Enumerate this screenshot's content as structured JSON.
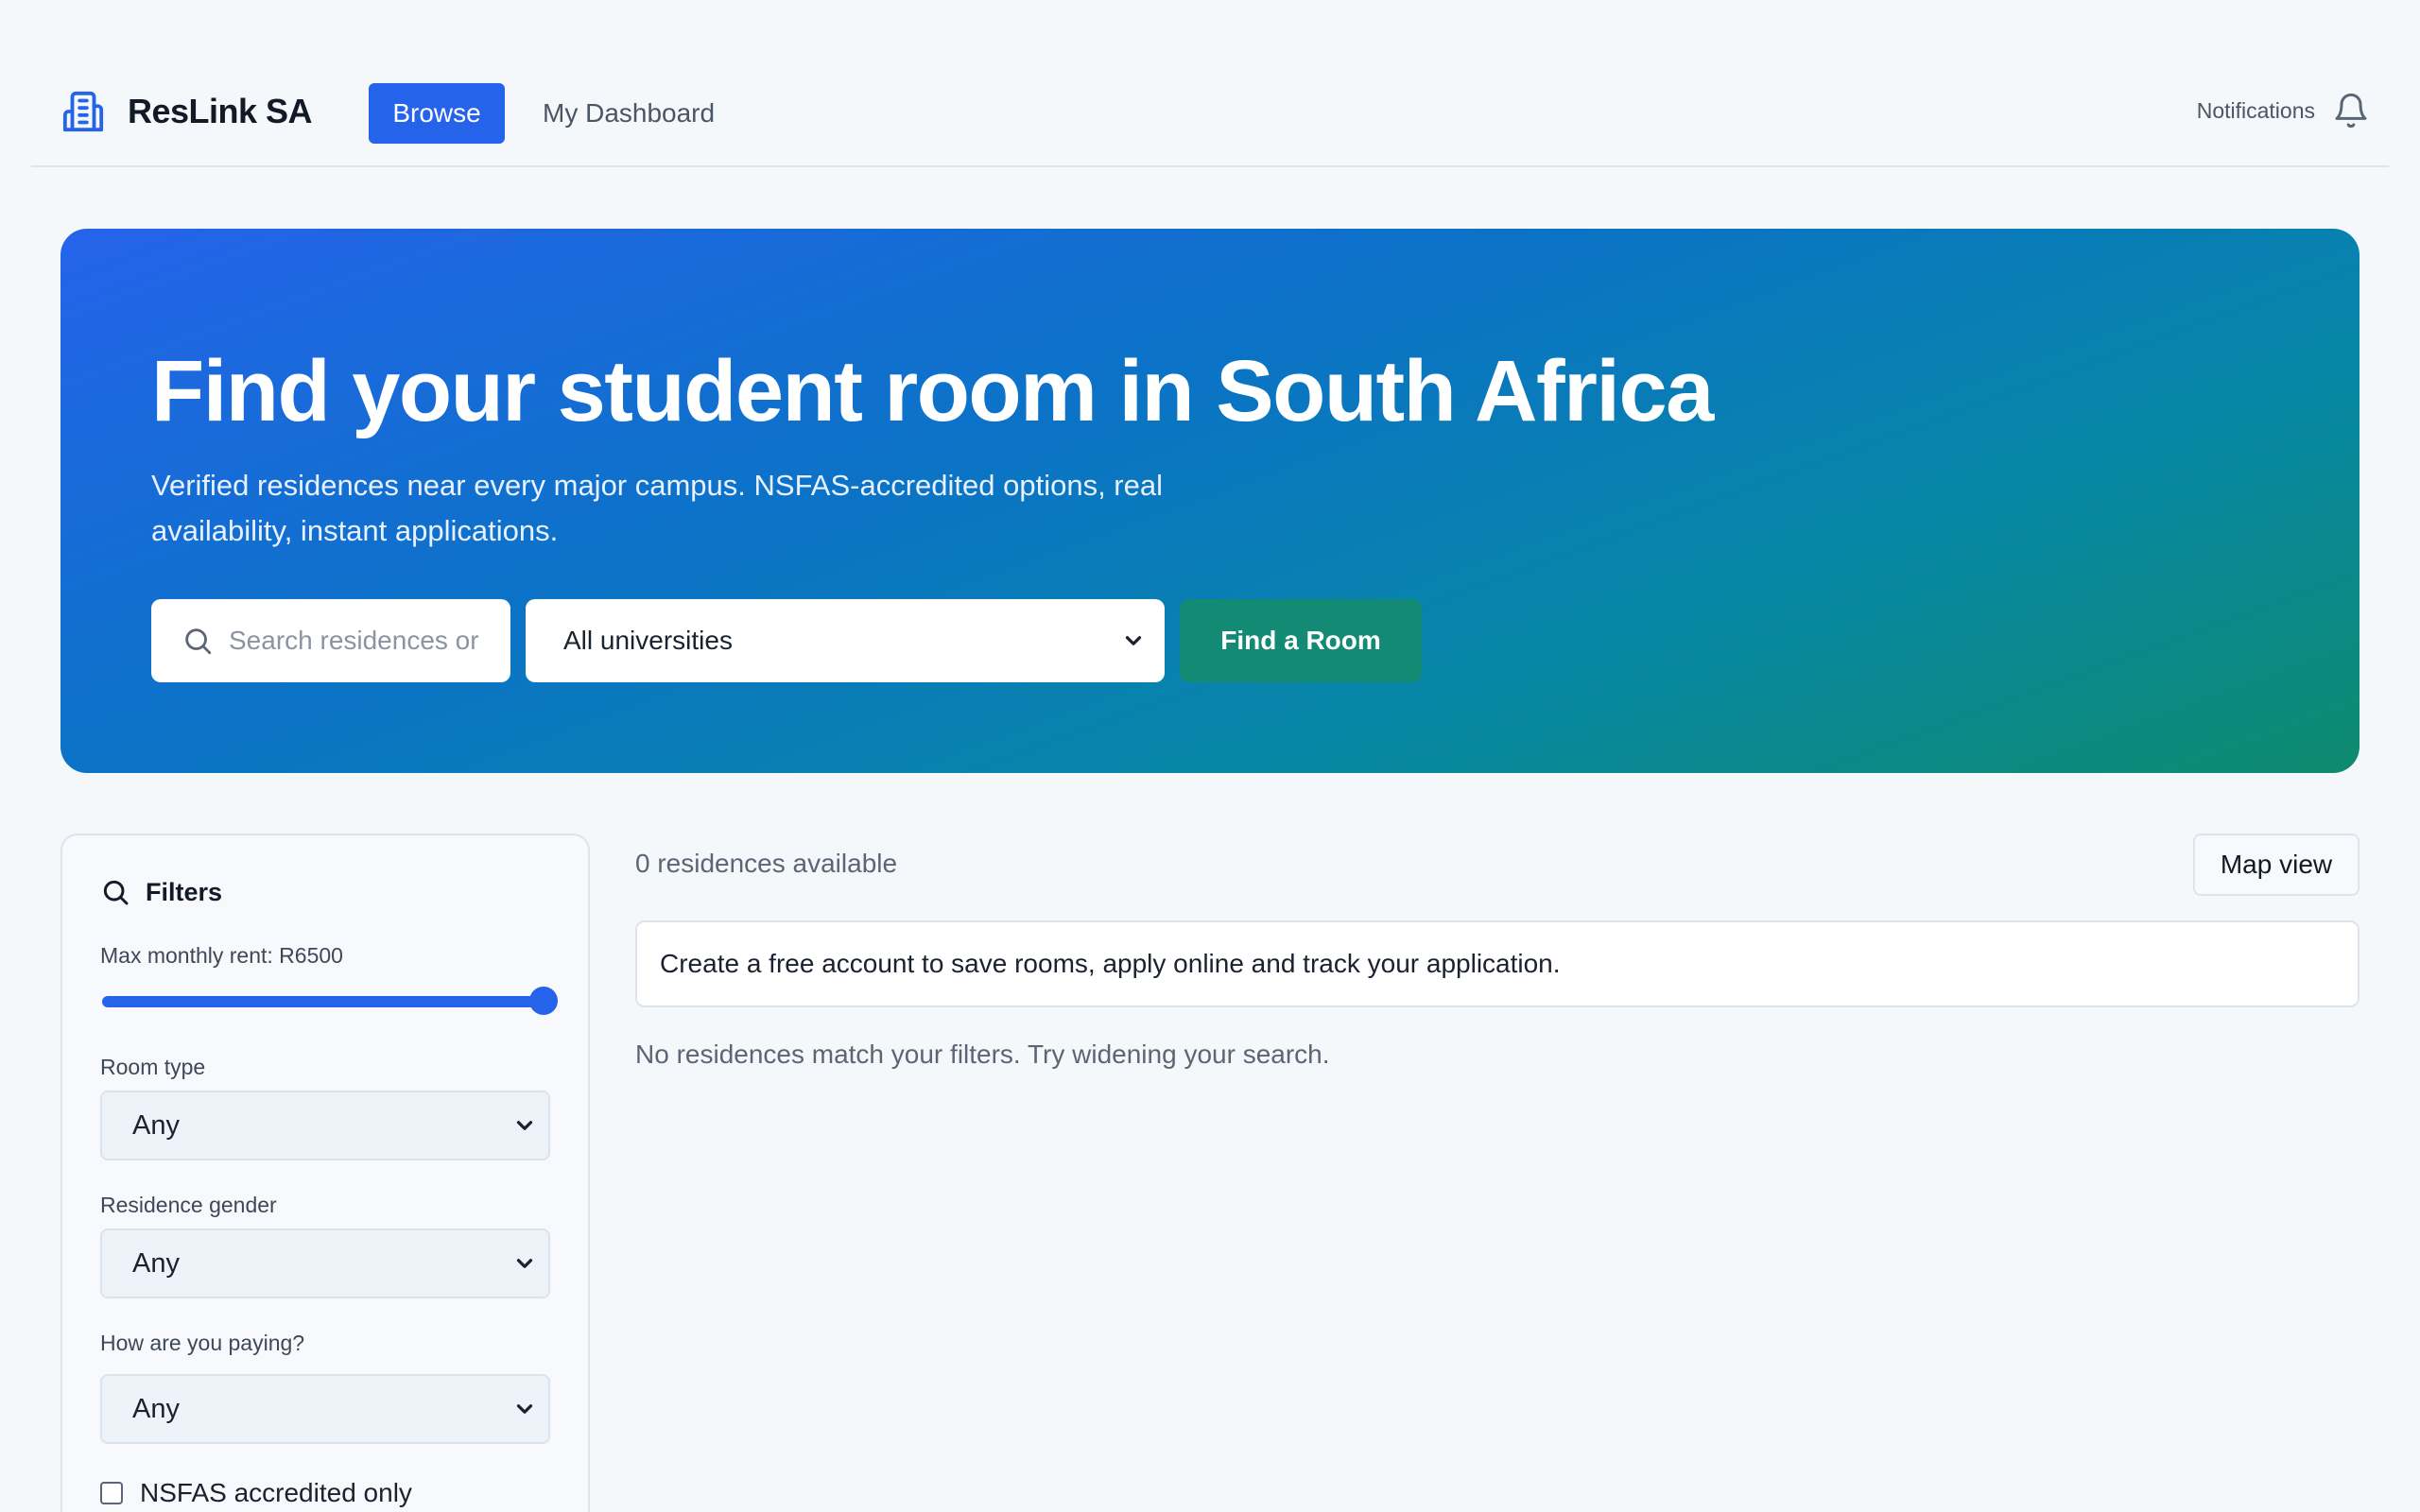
{
  "header": {
    "brand": "ResLink SA",
    "nav": {
      "browse": "Browse",
      "dashboard": "My Dashboard"
    },
    "notifications_label": "Notifications"
  },
  "hero": {
    "title": "Find your student room in South Africa",
    "subtitle": "Verified residences near every major campus. NSFAS-accredited options, real availability, instant applications.",
    "search_placeholder": "Search residences or",
    "university_select": "All universities",
    "find_button": "Find a Room"
  },
  "filters": {
    "title": "Filters",
    "max_rent_label": "Max monthly rent: R6500",
    "max_rent_fraction": 1.0,
    "room_type": {
      "label": "Room type",
      "value": "Any"
    },
    "gender": {
      "label": "Residence gender",
      "value": "Any"
    },
    "payment": {
      "label": "How are you paying?",
      "value": "Any"
    },
    "nsfas_only": {
      "label": "NSFAS accredited only",
      "checked": false
    }
  },
  "results": {
    "count": "0 residences available",
    "map_view": "Map view",
    "signup_notice": "Create a free account to save rooms, apply online and track your application.",
    "empty_message": "No residences match your filters. Try widening your search."
  },
  "colors": {
    "primary": "#2563eb",
    "accent_green": "#128a74",
    "background": "#f5f8fb"
  },
  "icons": [
    "building-icon",
    "bell-icon",
    "search-icon",
    "chevron-down-icon"
  ]
}
